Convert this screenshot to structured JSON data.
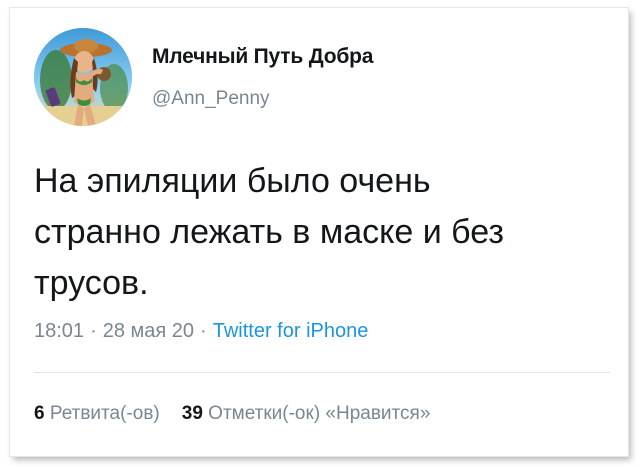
{
  "user": {
    "display_name": "Млечный Путь Добра",
    "handle": "@Ann_Penny"
  },
  "tweet": {
    "text": "На эпиляции было очень\nстранно лежать в маске и без\nтрусов."
  },
  "meta": {
    "time": "18:01",
    "date": "28 мая 20",
    "separator": "·",
    "source": "Twitter for iPhone"
  },
  "stats": {
    "retweets_count": "6",
    "retweets_label": "Ретвита(-ов)",
    "likes_count": "39",
    "likes_label": "Отметки(-ок) «Нравится»"
  },
  "colors": {
    "text": "#14171a",
    "secondary": "#7a8791",
    "link": "#1b95e0",
    "divider": "#e1e8ed"
  }
}
